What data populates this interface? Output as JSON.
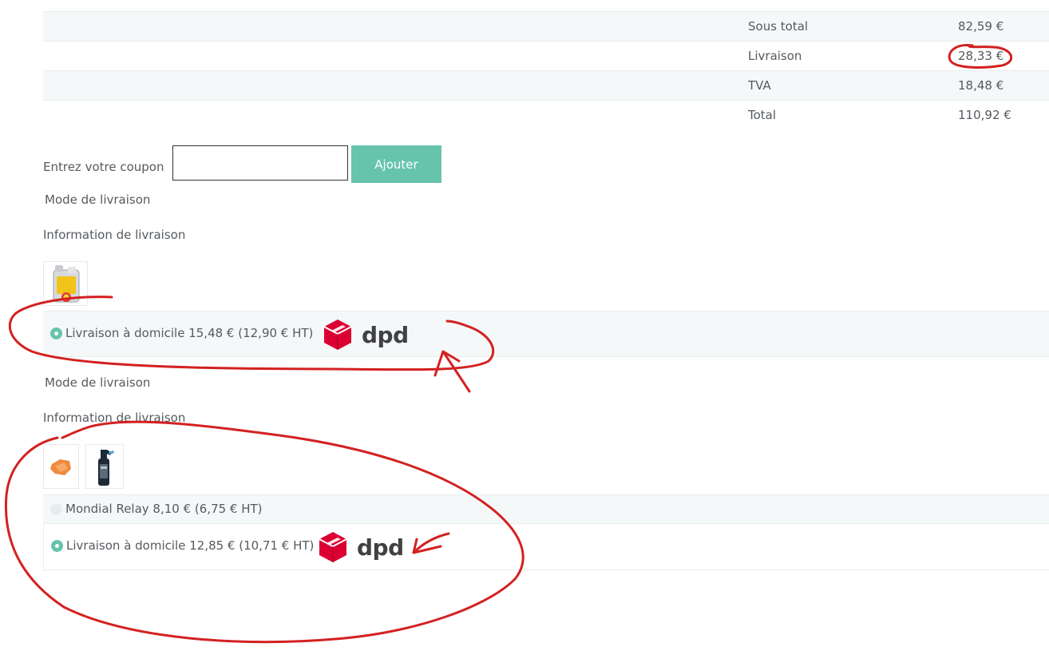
{
  "summary": {
    "rows": [
      {
        "label": "Sous total",
        "value": "82,59 €"
      },
      {
        "label": "Livraison",
        "value": "28,33 €"
      },
      {
        "label": "TVA",
        "value": "18,48 €"
      },
      {
        "label": "Total",
        "value": "110,92 €"
      }
    ]
  },
  "coupon": {
    "label": "Entrez votre coupon",
    "value": "",
    "button": "Ajouter"
  },
  "shipments": [
    {
      "mode_label": "Mode de livraison",
      "info_label": "Information de livraison",
      "products": [
        {
          "icon": "motor-oil-can-icon"
        }
      ],
      "options": [
        {
          "label": "Livraison à domicile 15,48 € (12,90 € HT)",
          "selected": true,
          "carrier_logo": "dpd-logo",
          "logo_text": "dpd"
        }
      ]
    },
    {
      "mode_label": "Mode de livraison",
      "info_label": "Information de livraison",
      "products": [
        {
          "icon": "cleaning-cloth-icon"
        },
        {
          "icon": "spray-bottle-icon"
        }
      ],
      "options": [
        {
          "label": "Mondial Relay 8,10 € (6,75 € HT)",
          "selected": false
        },
        {
          "label": "Livraison à domicile 12,85 € (10,71 € HT)",
          "selected": true,
          "carrier_logo": "dpd-logo",
          "logo_text": "dpd"
        }
      ]
    }
  ],
  "colors": {
    "accent": "#66c4ad",
    "row_alt": "#f4f8f8",
    "dpd_red": "#dc0032",
    "annotation_red": "#d32121"
  }
}
